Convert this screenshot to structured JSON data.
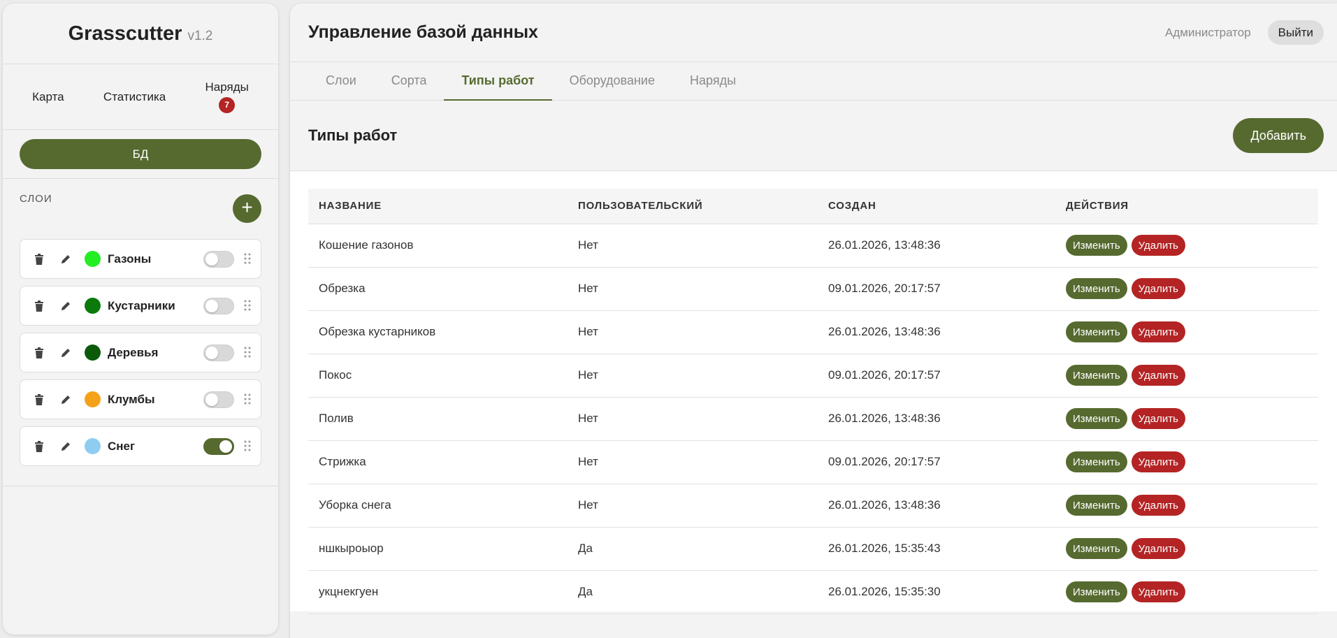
{
  "app": {
    "name": "Grasscutter",
    "version": "v1.2"
  },
  "nav": {
    "map": "Карта",
    "stats": "Статистика",
    "orders": "Наряды",
    "orders_badge": "7"
  },
  "db_button": "БД",
  "layers": {
    "title": "СЛОИ",
    "items": [
      {
        "name": "Газоны",
        "color": "#22ee22",
        "enabled": false
      },
      {
        "name": "Кустарники",
        "color": "#0b7a0b",
        "enabled": false
      },
      {
        "name": "Деревья",
        "color": "#0a5a0a",
        "enabled": false
      },
      {
        "name": "Клумбы",
        "color": "#f5a21a",
        "enabled": false
      },
      {
        "name": "Снег",
        "color": "#8ecdf0",
        "enabled": true
      }
    ]
  },
  "header": {
    "title": "Управление базой данных",
    "role": "Администратор",
    "logout": "Выйти"
  },
  "tabs": [
    {
      "label": "Слои",
      "active": false
    },
    {
      "label": "Сорта",
      "active": false
    },
    {
      "label": "Типы работ",
      "active": true
    },
    {
      "label": "Оборудование",
      "active": false
    },
    {
      "label": "Наряды",
      "active": false
    }
  ],
  "section": {
    "title": "Типы работ",
    "add_label": "Добавить"
  },
  "table": {
    "columns": [
      "НАЗВАНИЕ",
      "ПОЛЬЗОВАТЕЛЬСКИЙ",
      "СОЗДАН",
      "ДЕЙСТВИЯ"
    ],
    "edit_label": "Изменить",
    "delete_label": "Удалить",
    "rows": [
      {
        "name": "Кошение газонов",
        "custom": "Нет",
        "created": "26.01.2026, 13:48:36"
      },
      {
        "name": "Обрезка",
        "custom": "Нет",
        "created": "09.01.2026, 20:17:57"
      },
      {
        "name": "Обрезка кустарников",
        "custom": "Нет",
        "created": "26.01.2026, 13:48:36"
      },
      {
        "name": "Покос",
        "custom": "Нет",
        "created": "09.01.2026, 20:17:57"
      },
      {
        "name": "Полив",
        "custom": "Нет",
        "created": "26.01.2026, 13:48:36"
      },
      {
        "name": "Стрижка",
        "custom": "Нет",
        "created": "09.01.2026, 20:17:57"
      },
      {
        "name": "Уборка снега",
        "custom": "Нет",
        "created": "26.01.2026, 13:48:36"
      },
      {
        "name": "ншкыроыор",
        "custom": "Да",
        "created": "26.01.2026, 15:35:43"
      },
      {
        "name": "укцнекгуен",
        "custom": "Да",
        "created": "26.01.2026, 15:35:30"
      }
    ]
  },
  "colors": {
    "accent": "#566a30",
    "danger": "#b42424"
  }
}
